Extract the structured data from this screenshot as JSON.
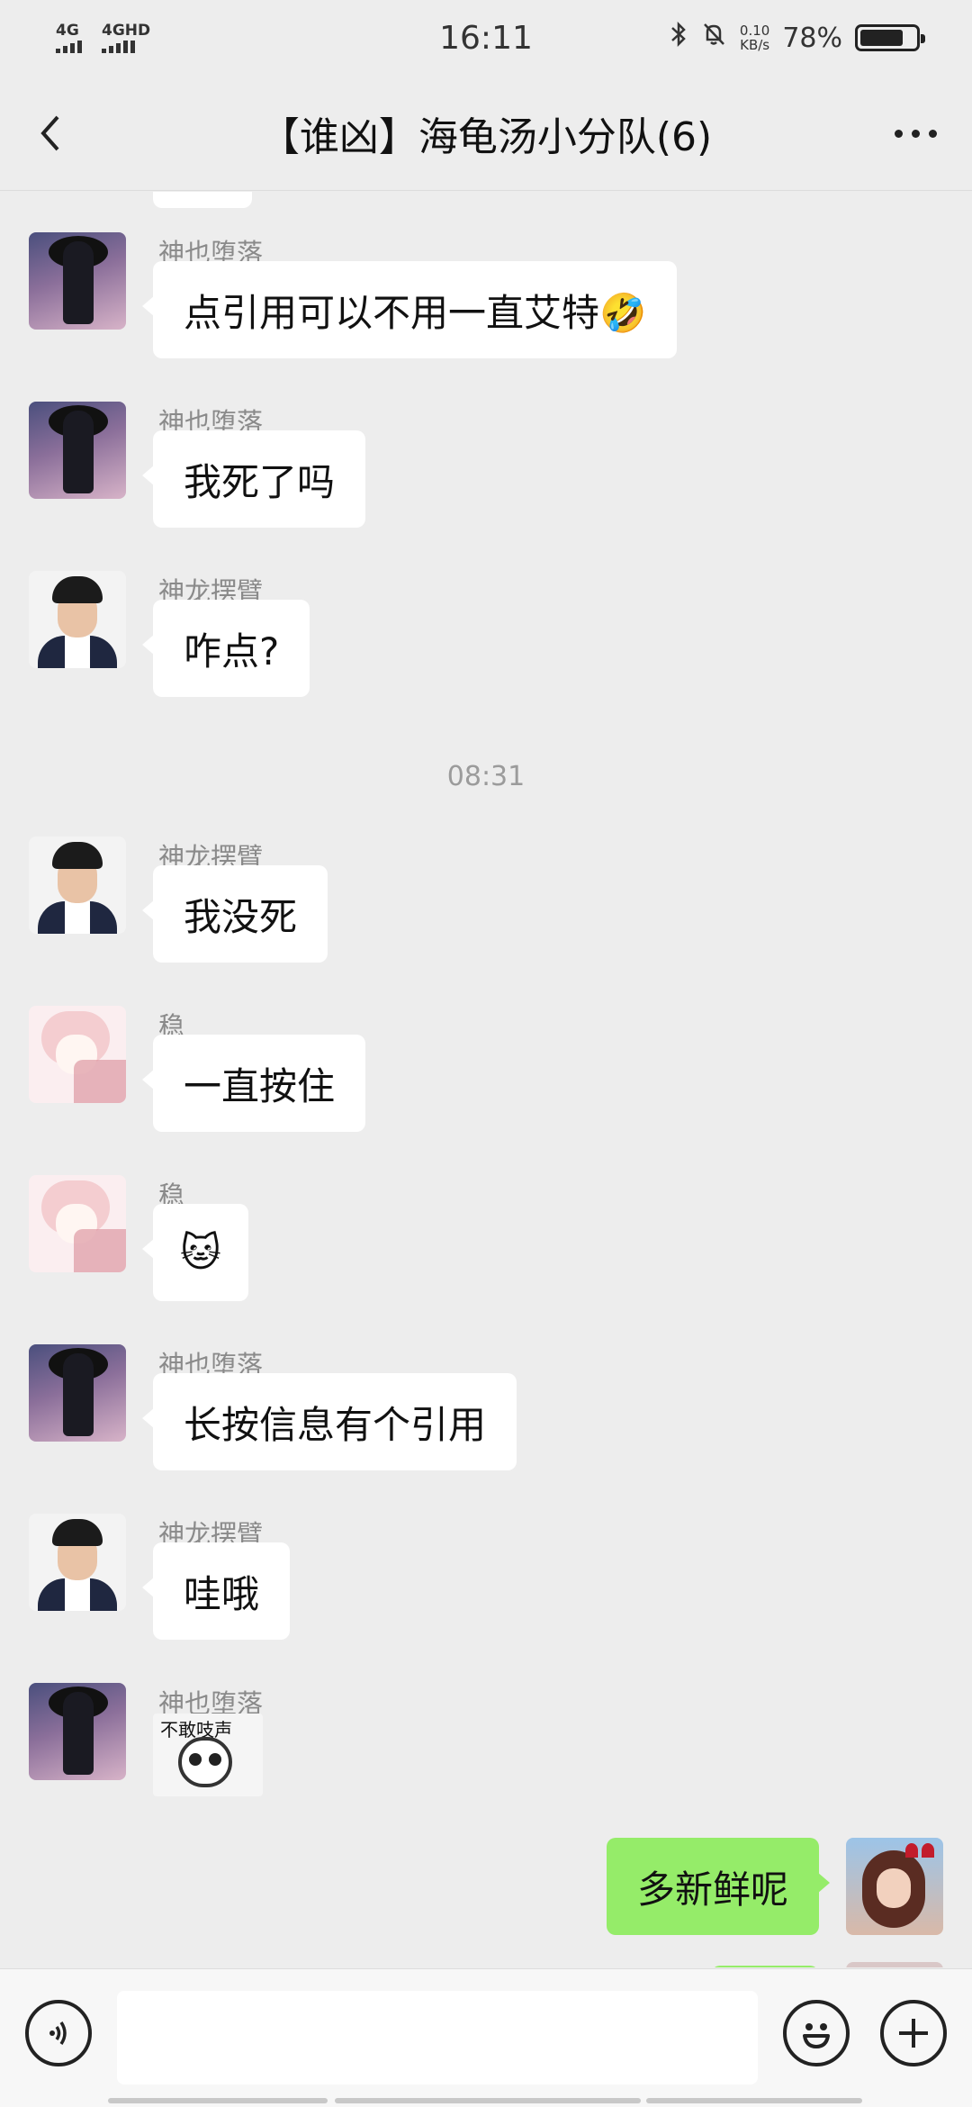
{
  "status_bar": {
    "signal1": "4G",
    "signal2": "4GHD",
    "time": "16:11",
    "net_speed_value": "0.10",
    "net_speed_unit": "KB/s",
    "battery_percent": "78%",
    "battery_level": 0.78
  },
  "nav": {
    "title": "【谁凶】海龟汤小分队(6)"
  },
  "chat": {
    "messages": [
      {
        "sender": "神也堕落",
        "text": "点引用可以不用一直艾特🤣"
      },
      {
        "sender": "神也堕落",
        "text": "我死了吗"
      },
      {
        "sender": "神龙摆臂",
        "text": "咋点?"
      },
      {
        "timestamp": "08:31"
      },
      {
        "sender": "神龙摆臂",
        "text": "我没死"
      },
      {
        "sender": "稳",
        "text": "一直按住"
      },
      {
        "sender": "稳",
        "text": "🐱"
      },
      {
        "sender": "神也堕落",
        "text": "长按信息有个引用"
      },
      {
        "sender": "神龙摆臂",
        "text": "哇哦"
      },
      {
        "sender": "神也堕落",
        "sticker_caption": "不敢吱声"
      },
      {
        "self": true,
        "text": "多新鲜呢"
      }
    ]
  },
  "input_bar": {
    "placeholder": ""
  },
  "colors": {
    "background": "#ededed",
    "self_bubble": "#95ec69",
    "other_bubble": "#ffffff"
  }
}
